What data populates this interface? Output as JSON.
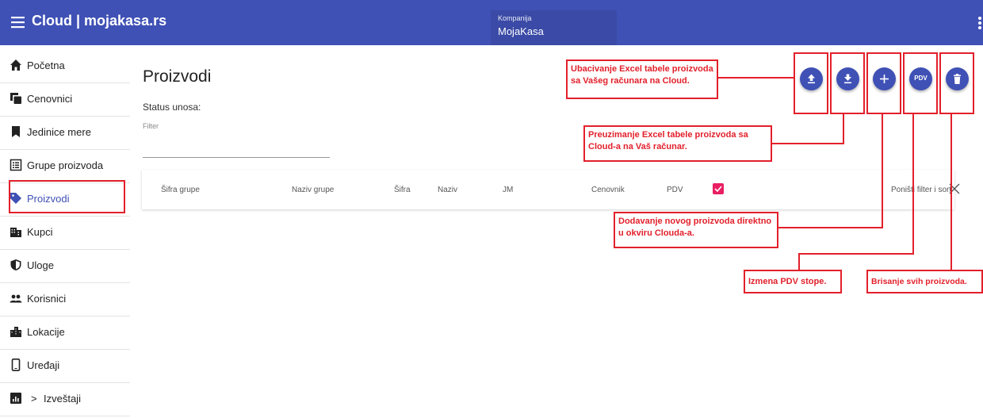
{
  "app": {
    "title": "Cloud | mojakasa.rs",
    "company_label": "Kompanija",
    "company_value": "MojaKasa"
  },
  "sidebar": {
    "items": [
      {
        "label": "Početna",
        "icon": "home-icon"
      },
      {
        "label": "Cenovnici",
        "icon": "price-list-icon"
      },
      {
        "label": "Jedinice mere",
        "icon": "bookmark-icon"
      },
      {
        "label": "Grupe proizvoda",
        "icon": "list-icon"
      },
      {
        "label": "Proizvodi",
        "icon": "tag-icon",
        "active": true
      },
      {
        "label": "Kupci",
        "icon": "building-icon"
      },
      {
        "label": "Uloge",
        "icon": "shield-icon"
      },
      {
        "label": "Korisnici",
        "icon": "users-icon"
      },
      {
        "label": "Lokacije",
        "icon": "city-icon"
      },
      {
        "label": "Uređaji",
        "icon": "phone-icon"
      },
      {
        "label": "Izveštaji",
        "icon": "report-icon",
        "expand": ">"
      }
    ]
  },
  "main": {
    "title": "Proizvodi",
    "status_label": "Status unosa:",
    "filter_label": "Filter",
    "filter_value": ""
  },
  "table": {
    "columns": [
      "Šifra grupe",
      "Naziv grupe",
      "Šifra",
      "Naziv",
      "JM",
      "Cenovnik",
      "PDV"
    ],
    "pdv_checked": true,
    "reset_label": "Poništi filter i sort"
  },
  "actions": {
    "upload_icon": "upload-icon",
    "download_icon": "download-icon",
    "add_icon": "plus-icon",
    "pdv_label": "PDV",
    "delete_icon": "trash-icon"
  },
  "callouts": {
    "upload": "Ubacivanje Excel tabele proizvoda sa Vašeg računara na Cloud.",
    "download": "Preuzimanje Excel tabele proizvoda sa Cloud-a na Vaš računar.",
    "add": "Dodavanje novog proizvoda direktno u okviru Clouda-a.",
    "pdv": "Izmena PDV stope.",
    "delete": "Brisanje svih proizvoda."
  },
  "colors": {
    "primary": "#3f51b5",
    "annotation": "#e2202b",
    "checkbox": "#e91e63"
  }
}
